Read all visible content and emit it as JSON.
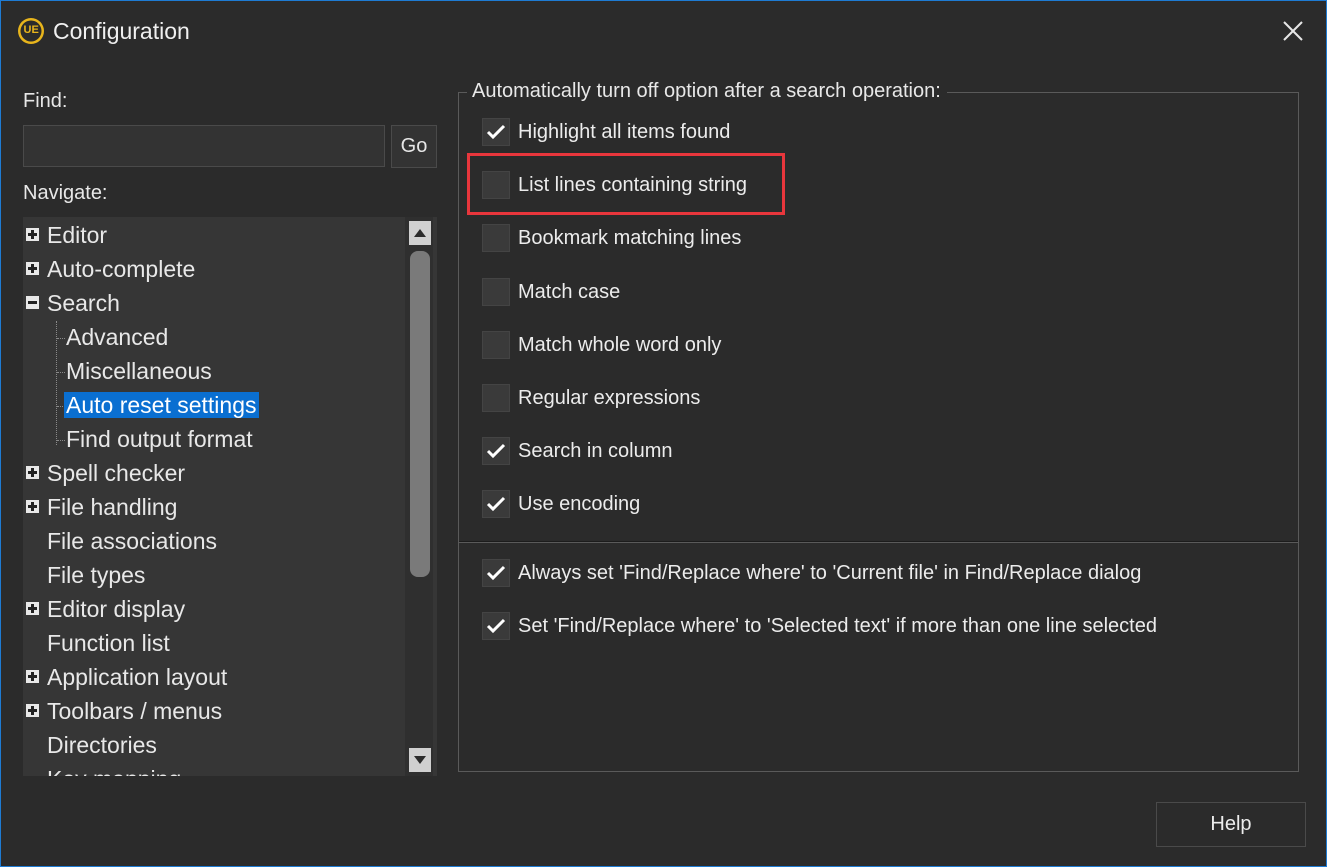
{
  "window": {
    "title": "Configuration",
    "logo_text": "UE",
    "accent_color": "#1e7bd3"
  },
  "find": {
    "label": "Find:",
    "value": "",
    "placeholder": "",
    "go_label": "Go"
  },
  "navigate": {
    "label": "Navigate:",
    "items": [
      {
        "label": "Editor",
        "expander": "plus"
      },
      {
        "label": "Auto-complete",
        "expander": "plus"
      },
      {
        "label": "Search",
        "expander": "minus"
      },
      {
        "label": "Advanced",
        "expander": "none"
      },
      {
        "label": "Miscellaneous",
        "expander": "none"
      },
      {
        "label": "Auto reset settings",
        "expander": "none",
        "selected": true
      },
      {
        "label": "Find output format",
        "expander": "none"
      },
      {
        "label": "Spell checker",
        "expander": "plus"
      },
      {
        "label": "File handling",
        "expander": "plus"
      },
      {
        "label": "File associations",
        "expander": "none"
      },
      {
        "label": "File types",
        "expander": "none"
      },
      {
        "label": "Editor display",
        "expander": "plus"
      },
      {
        "label": "Function list",
        "expander": "none"
      },
      {
        "label": "Application layout",
        "expander": "plus"
      },
      {
        "label": "Toolbars / menus",
        "expander": "plus"
      },
      {
        "label": "Directories",
        "expander": "none"
      },
      {
        "label": "Key mapping",
        "expander": "none"
      }
    ]
  },
  "auto_off_group": {
    "title": "Automatically turn off option after a search operation:",
    "options": [
      {
        "label": "Highlight all items found",
        "checked": true
      },
      {
        "label": "List lines containing string",
        "checked": false
      },
      {
        "label": "Bookmark matching lines",
        "checked": false
      },
      {
        "label": "Match case",
        "checked": false
      },
      {
        "label": "Match whole word only",
        "checked": false
      },
      {
        "label": "Regular expressions",
        "checked": false
      },
      {
        "label": "Search in column",
        "checked": true
      },
      {
        "label": "Use encoding",
        "checked": true
      }
    ]
  },
  "other_options": [
    {
      "label": "Always set 'Find/Replace where' to 'Current file' in Find/Replace dialog",
      "checked": true
    },
    {
      "label": "Set 'Find/Replace where' to 'Selected text' if more than one line selected",
      "checked": true
    }
  ],
  "highlight_color": "#e8363c",
  "selection_color": "#0a6fd1",
  "footer": {
    "help_label": "Help"
  }
}
